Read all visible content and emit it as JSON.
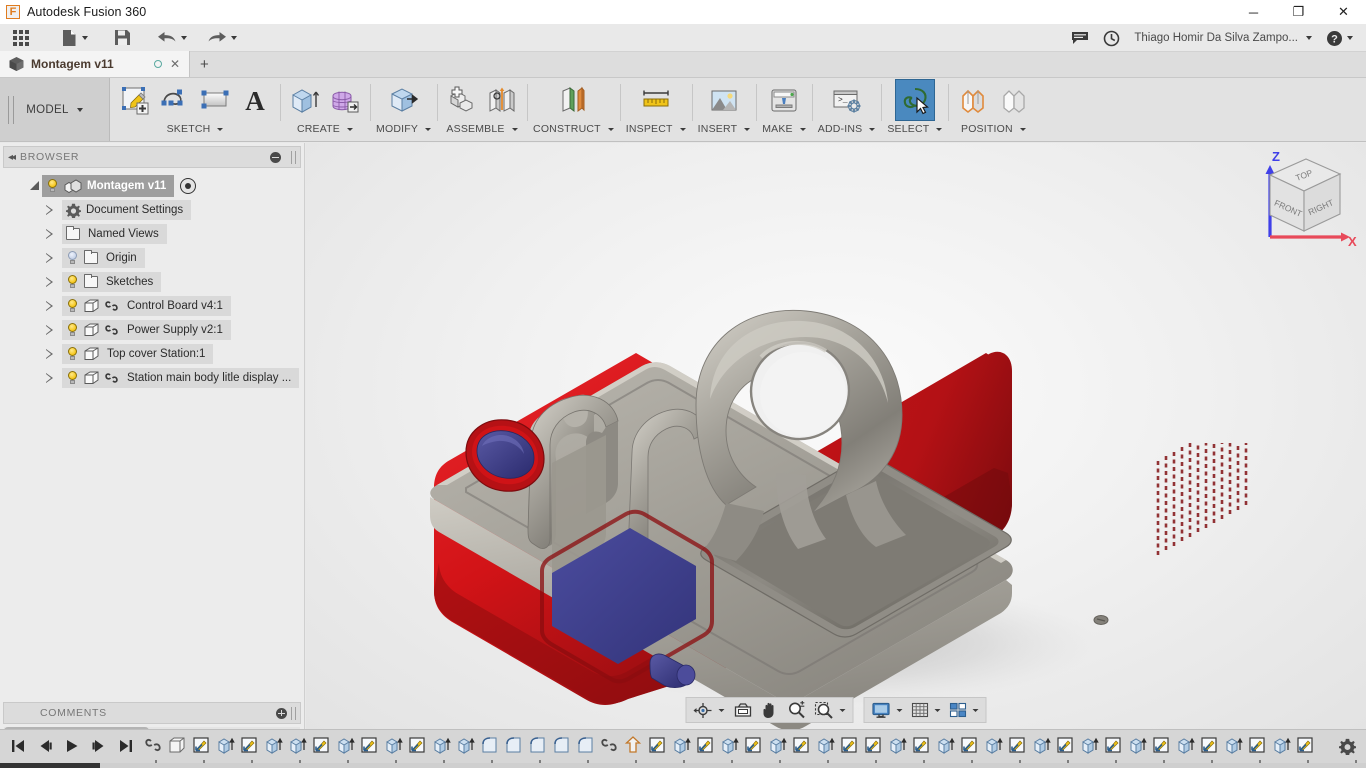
{
  "window": {
    "app_title": "Autodesk Fusion 360",
    "app_icon": "fusion-f-icon",
    "minimize_label": "─",
    "maximize_label": "❐",
    "close_label": "✕"
  },
  "quick_access": {
    "items": [
      {
        "name": "app-grid-button",
        "icon": "grid-9-dots-icon",
        "label": ""
      },
      {
        "name": "new-file-button",
        "icon": "file-icon",
        "label": "",
        "has_caret": true
      },
      {
        "name": "save-button",
        "icon": "save-floppy-icon",
        "label": ""
      },
      {
        "name": "undo-button",
        "icon": "undo-arrow-icon",
        "label": "",
        "has_caret": true
      },
      {
        "name": "redo-button",
        "icon": "redo-arrow-icon",
        "label": "",
        "has_caret": true
      }
    ],
    "right": {
      "comment_icon": "speech-bubble-icon",
      "history_icon": "clock-icon",
      "user_name": "Thiago Homir Da Silva Zampo...",
      "help_icon": "help-question-icon"
    }
  },
  "tabs": {
    "document_tab": {
      "icon": "cube-icon",
      "label": "Montagem v11",
      "status_dot": "unsaved-circle-icon",
      "close": "✕"
    },
    "new_tab_label": "+"
  },
  "ribbon": {
    "workspace_selector": {
      "label": "MODEL"
    },
    "groups": [
      {
        "label": "SKETCH",
        "name": "ribbon-group-sketch",
        "tools": [
          {
            "name": "create-sketch-tool",
            "icon": "sketch-pencil-icon"
          },
          {
            "name": "spline-tool",
            "icon": "spline-curve-icon"
          },
          {
            "name": "rectangle-tool",
            "icon": "rectangle-icon"
          },
          {
            "name": "text-tool",
            "icon": "text-a-icon"
          }
        ]
      },
      {
        "label": "CREATE",
        "name": "ribbon-group-create",
        "tools": [
          {
            "name": "extrude-tool",
            "icon": "extrude-box-icon"
          },
          {
            "name": "create-form-tool",
            "icon": "tspline-mesh-icon"
          }
        ]
      },
      {
        "label": "MODIFY",
        "name": "ribbon-group-modify",
        "tools": [
          {
            "name": "press-pull-tool",
            "icon": "press-pull-icon"
          }
        ]
      },
      {
        "label": "ASSEMBLE",
        "name": "ribbon-group-assemble",
        "tools": [
          {
            "name": "new-component-tool",
            "icon": "new-component-icon"
          },
          {
            "name": "joint-tool",
            "icon": "joint-icon"
          }
        ]
      },
      {
        "label": "CONSTRUCT",
        "name": "ribbon-group-construct",
        "tools": [
          {
            "name": "offset-plane-tool",
            "icon": "offset-plane-icon"
          }
        ]
      },
      {
        "label": "INSPECT",
        "name": "ribbon-group-inspect",
        "tools": [
          {
            "name": "measure-tool",
            "icon": "ruler-measure-icon"
          }
        ]
      },
      {
        "label": "INSERT",
        "name": "ribbon-group-insert",
        "tools": [
          {
            "name": "insert-mcmaster-tool",
            "icon": "picture-landscape-icon"
          }
        ]
      },
      {
        "label": "MAKE",
        "name": "ribbon-group-make",
        "tools": [
          {
            "name": "3d-print-tool",
            "icon": "3d-printer-icon"
          }
        ]
      },
      {
        "label": "ADD-INS",
        "name": "ribbon-group-addins",
        "tools": [
          {
            "name": "scripts-addins-tool",
            "icon": "console-gear-icon"
          }
        ]
      },
      {
        "label": "SELECT",
        "name": "ribbon-group-select",
        "active": true,
        "tools": [
          {
            "name": "select-tool",
            "icon": "lasso-cursor-icon",
            "active": true
          }
        ]
      },
      {
        "label": "POSITION",
        "name": "ribbon-group-position",
        "tools": [
          {
            "name": "move-component-tool",
            "icon": "position-orange-icon"
          },
          {
            "name": "align-tool",
            "icon": "align-grey-icon"
          }
        ]
      }
    ]
  },
  "browser": {
    "header": {
      "title": "BROWSER",
      "collapse_icon": "double-left-arrow-icon",
      "minimize_icon": "minus-circle-icon"
    },
    "tree": [
      {
        "name": "tree-root-montagem",
        "label": "Montagem v11",
        "icon": "assembly-cube-icon",
        "bulb": "on",
        "expander": "open",
        "root": true,
        "indent": 0,
        "has_target": true
      },
      {
        "name": "tree-item-document-settings",
        "label": "Document Settings",
        "icon": "gear-icon",
        "bulb": "none",
        "expander": "closed",
        "indent": 1
      },
      {
        "name": "tree-item-named-views",
        "label": "Named Views",
        "icon": "folder-icon",
        "bulb": "none",
        "expander": "closed",
        "indent": 1
      },
      {
        "name": "tree-item-origin",
        "label": "Origin",
        "icon": "folder-icon",
        "bulb": "off",
        "expander": "closed",
        "indent": 1
      },
      {
        "name": "tree-item-sketches",
        "label": "Sketches",
        "icon": "folder-icon",
        "bulb": "on",
        "expander": "closed",
        "indent": 1
      },
      {
        "name": "tree-item-control-board",
        "label": "Control Board v4:1",
        "icon": "body-cube-icon",
        "bulb": "on",
        "expander": "closed",
        "indent": 1,
        "linked": true
      },
      {
        "name": "tree-item-power-supply",
        "label": "Power Supply v2:1",
        "icon": "body-cube-icon",
        "bulb": "on",
        "expander": "closed",
        "indent": 1,
        "linked": true
      },
      {
        "name": "tree-item-top-cover-station",
        "label": "Top cover Station:1",
        "icon": "body-cube-icon",
        "bulb": "on",
        "expander": "closed",
        "indent": 1,
        "linked": false
      },
      {
        "name": "tree-item-station-main-body",
        "label": "Station main body litle display ...",
        "icon": "body-cube-icon",
        "bulb": "on",
        "expander": "closed",
        "indent": 1,
        "linked": true
      }
    ],
    "comments": {
      "label": "COMMENTS",
      "add_icon": "plus-circle-icon"
    }
  },
  "canvas": {
    "viewcube": {
      "top_face": "TOP",
      "front_face": "FRONT",
      "right_face": "RIGHT",
      "axis_z": "Z",
      "axis_x": "X",
      "z_color": "#4040e8",
      "x_color": "#e84a5a"
    },
    "model": {
      "name": "soldering-station-assembly",
      "body_color": "#cf1418",
      "cover_color": "#9a9790",
      "display_color": "#3e3f8f",
      "knob_color": "#42418e"
    },
    "navigation_bar": {
      "group1": [
        {
          "name": "orbit-tool",
          "icon": "orbit-icon",
          "has_caret": true
        },
        {
          "name": "look-at-tool",
          "icon": "look-at-icon",
          "has_caret": false
        },
        {
          "name": "pan-tool",
          "icon": "hand-pan-icon",
          "has_caret": false
        },
        {
          "name": "zoom-tool",
          "icon": "zoom-magnifier-icon",
          "has_caret": false
        },
        {
          "name": "zoom-window-tool",
          "icon": "zoom-window-icon",
          "has_caret": true
        }
      ],
      "group2": [
        {
          "name": "display-settings-button",
          "icon": "monitor-icon",
          "has_caret": true
        },
        {
          "name": "grid-snaps-button",
          "icon": "grid-icon",
          "has_caret": true
        },
        {
          "name": "viewports-button",
          "icon": "viewports-icon",
          "has_caret": true
        }
      ]
    }
  },
  "timeline": {
    "playback": [
      {
        "name": "timeline-go-to-beginning",
        "icon": "skip-start-icon"
      },
      {
        "name": "timeline-step-back",
        "icon": "step-back-icon"
      },
      {
        "name": "timeline-play",
        "icon": "play-icon"
      },
      {
        "name": "timeline-step-forward",
        "icon": "step-forward-icon"
      },
      {
        "name": "timeline-go-to-end",
        "icon": "skip-end-icon"
      }
    ],
    "features": [
      "link",
      "body",
      "sketch",
      "extrude",
      "sketch",
      "extrude",
      "extrude",
      "sketch",
      "extrude",
      "sketch",
      "extrude",
      "sketch",
      "extrude",
      "extrude",
      "fillet",
      "fillet",
      "fillet",
      "fillet",
      "fillet",
      "link",
      "move",
      "sketch",
      "extrude",
      "sketch",
      "extrude",
      "sketch",
      "extrude",
      "sketch",
      "extrude",
      "sketch",
      "sketch",
      "extrude",
      "sketch",
      "extrude",
      "sketch",
      "extrude",
      "sketch",
      "extrude",
      "sketch",
      "extrude",
      "sketch",
      "extrude",
      "sketch",
      "extrude",
      "sketch",
      "extrude",
      "sketch",
      "extrude",
      "sketch"
    ],
    "settings_icon": "gear-icon"
  }
}
